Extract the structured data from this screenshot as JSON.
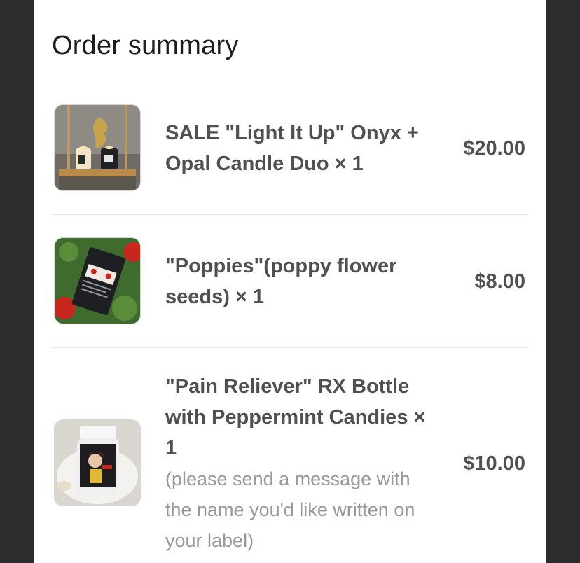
{
  "title": "Order summary",
  "items": [
    {
      "name": "SALE \"Light It Up\" Onyx + Opal Candle Duo × 1",
      "note": "",
      "price": "$20.00",
      "image": "candle-duo-on-shelf"
    },
    {
      "name": "\"Poppies\"(poppy flower seeds) × 1",
      "note": "",
      "price": "$8.00",
      "image": "poppy-seed-packet"
    },
    {
      "name": "\"Pain Reliever\" RX Bottle with Peppermint Candies × 1",
      "note": "(please send a message with the name you'd like written on your label)",
      "price": "$10.00",
      "image": "rx-bottle"
    }
  ],
  "colors": {
    "background": "#2c2c2e",
    "sheet": "#ffffff",
    "text": "#505052",
    "muted": "#98989b",
    "divider": "#e3e3e5"
  }
}
